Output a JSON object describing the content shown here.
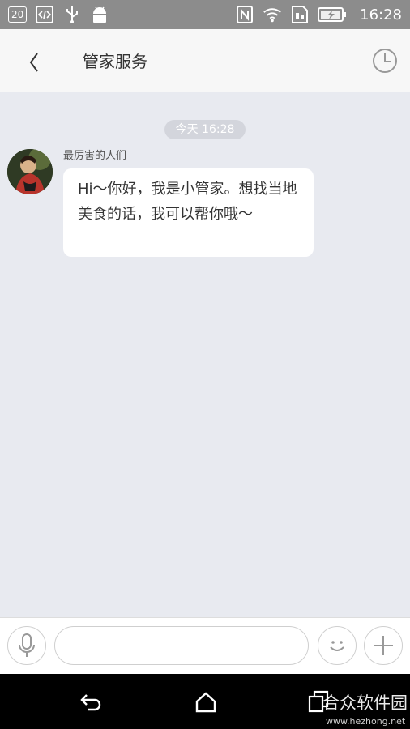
{
  "status_bar": {
    "notification_count": "20",
    "time": "16:28",
    "icons": [
      "notification-badge-icon",
      "code-icon",
      "usb-icon",
      "android-icon",
      "nfc-icon",
      "wifi-icon",
      "sim-icon",
      "battery-charging-icon"
    ]
  },
  "header": {
    "title": "管家服务",
    "back_icon": "chevron-left-icon",
    "history_icon": "clock-icon"
  },
  "chat": {
    "timestamp": "今天 16:28",
    "messages": [
      {
        "sender": "最厉害的人们",
        "text": "Hi～你好，我是小管家。想找当地美食的话，我可以帮你哦～"
      }
    ]
  },
  "input_bar": {
    "voice_icon": "microphone-icon",
    "input_value": "",
    "emoji_icon": "smiley-icon",
    "plus_icon": "plus-icon"
  },
  "nav_bar": {
    "icons": [
      "back-icon",
      "home-icon",
      "recent-apps-icon"
    ],
    "watermark_text": "合众软件园",
    "watermark_url": "www.hezhong.net"
  },
  "colors": {
    "status_bar": "#8c8c8c",
    "header_bg": "#f7f7f7",
    "chat_bg": "#e8eaf0",
    "bubble_bg": "#ffffff",
    "nav_bg": "#000000"
  }
}
